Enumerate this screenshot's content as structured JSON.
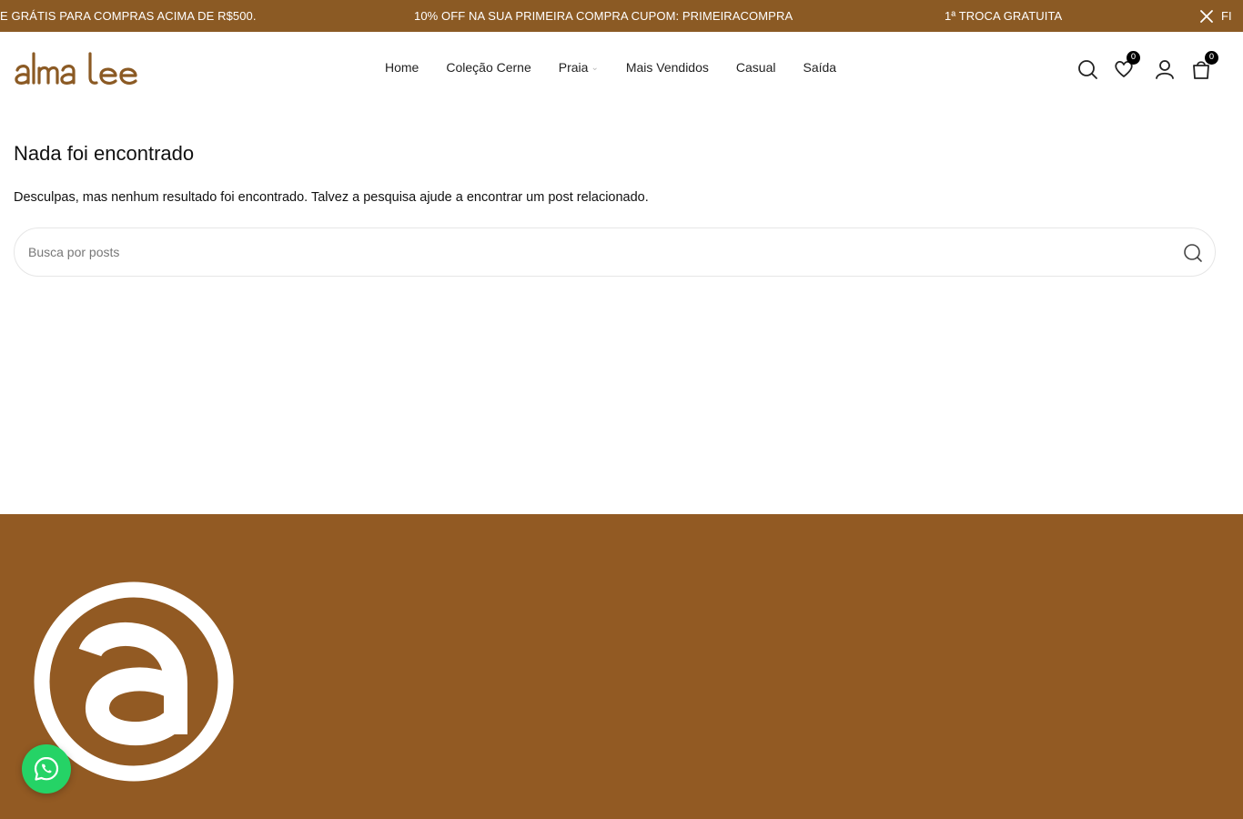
{
  "announcement": {
    "messages": [
      "E GRÁTIS PARA COMPRAS ACIMA DE R$500.",
      "10% OFF NA SUA PRIMEIRA COMPRA CUPOM: PRIMEIRACOMPRA",
      "1ª TROCA GRATUITA",
      "FI"
    ],
    "background": "#8b5a24",
    "close_icon": "close-icon"
  },
  "header": {
    "logo_text": "alma lee",
    "brand_color": "#8b5a24",
    "nav": [
      {
        "label": "Home"
      },
      {
        "label": "Coleção Cerne"
      },
      {
        "label": "Praia",
        "has_dropdown": true
      },
      {
        "label": "Mais Vendidos"
      },
      {
        "label": "Casual"
      },
      {
        "label": "Saída"
      }
    ],
    "icons": {
      "search": "search-icon",
      "wishlist": "heart-icon",
      "wishlist_count": "0",
      "account": "user-icon",
      "cart": "bag-icon",
      "cart_count": "0"
    }
  },
  "main": {
    "title": "Nada foi encontrado",
    "description": "Desculpas, mas nenhum resultado foi encontrado. Talvez a pesquisa ajude a encontrar um post relacionado.",
    "search": {
      "placeholder": "Busca por posts",
      "value": "",
      "icon": "search-icon"
    }
  },
  "footer": {
    "background": "#925a23",
    "logo_icon": "alma-lee-circle-logo-icon"
  },
  "whatsapp": {
    "icon": "whatsapp-icon",
    "color": "#25d366"
  }
}
